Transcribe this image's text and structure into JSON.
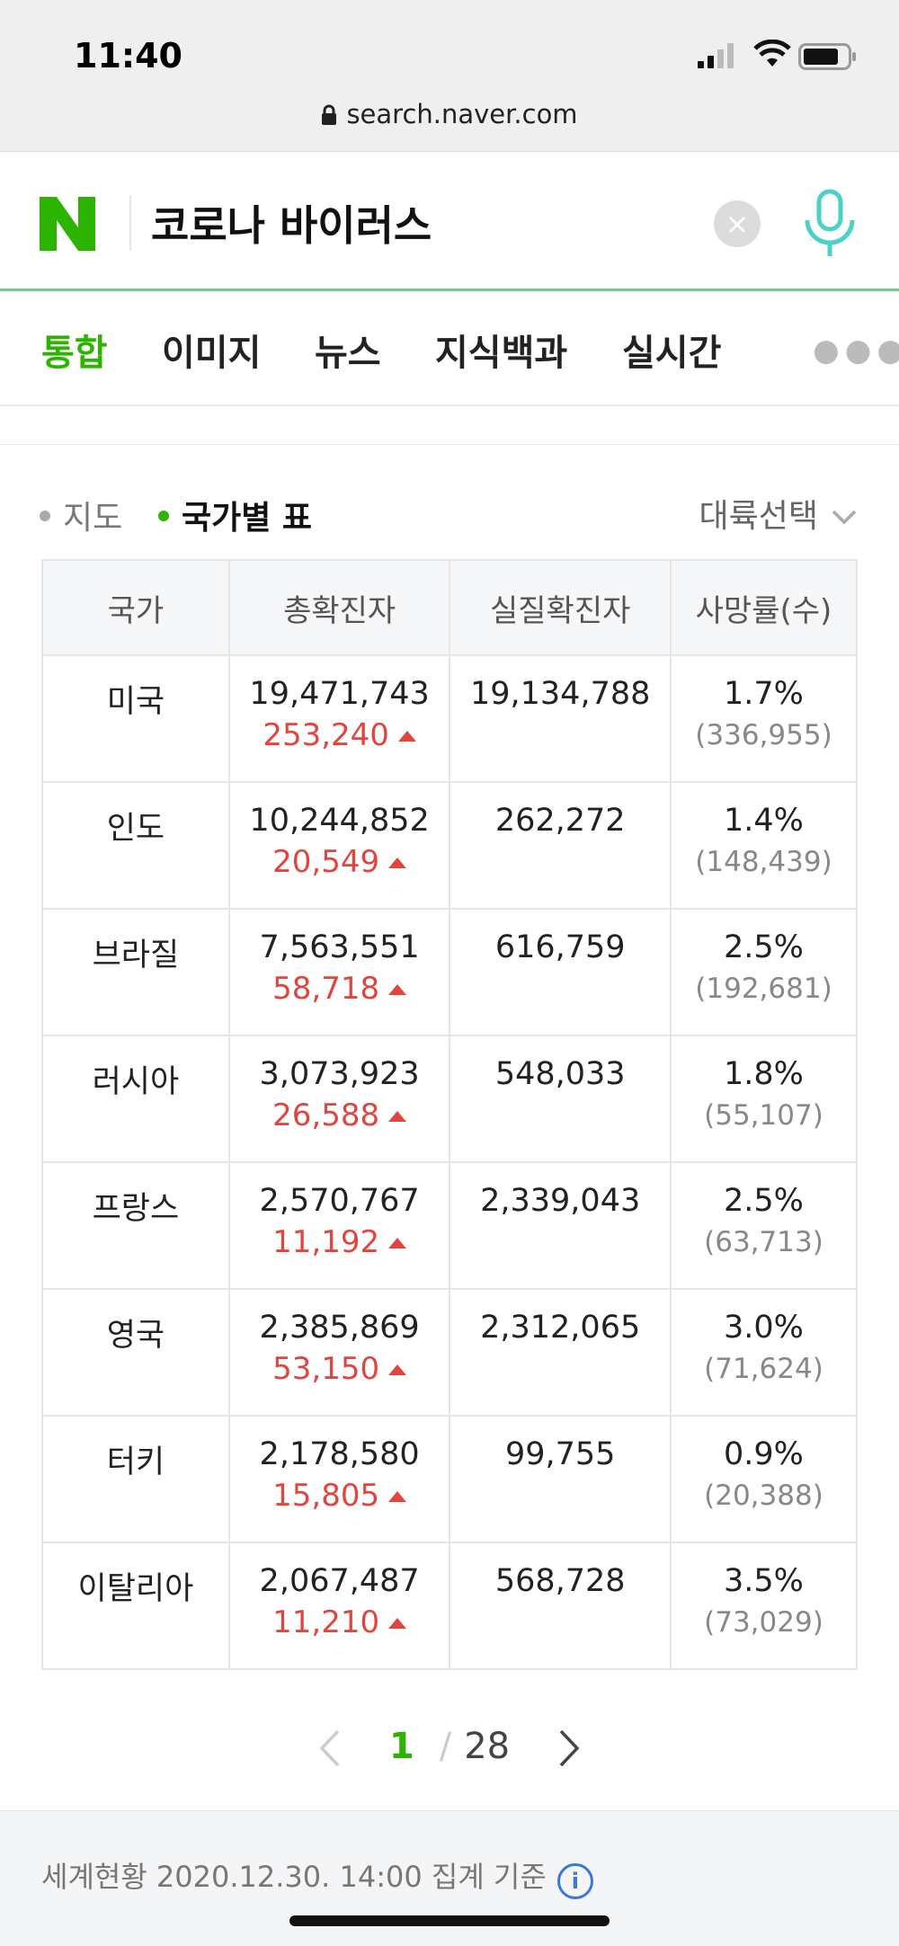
{
  "status": {
    "time": "11:40"
  },
  "browser": {
    "url": "search.naver.com"
  },
  "search": {
    "query": "코로나 바이러스",
    "clear_label": "×"
  },
  "tabs": [
    "통합",
    "이미지",
    "뉴스",
    "지식백과",
    "실시간"
  ],
  "view": {
    "map_label": "지도",
    "table_label": "국가별 표",
    "region_label": "대륙선택"
  },
  "table": {
    "headers": [
      "국가",
      "총확진자",
      "실질확진자",
      "사망률(수)"
    ],
    "rows": [
      {
        "country": "미국",
        "total": "19,471,743",
        "increase": "253,240",
        "actual": "19,134,788",
        "rate": "1.7%",
        "deaths": "(336,955)"
      },
      {
        "country": "인도",
        "total": "10,244,852",
        "increase": "20,549",
        "actual": "262,272",
        "rate": "1.4%",
        "deaths": "(148,439)"
      },
      {
        "country": "브라질",
        "total": "7,563,551",
        "increase": "58,718",
        "actual": "616,759",
        "rate": "2.5%",
        "deaths": "(192,681)"
      },
      {
        "country": "러시아",
        "total": "3,073,923",
        "increase": "26,588",
        "actual": "548,033",
        "rate": "1.8%",
        "deaths": "(55,107)"
      },
      {
        "country": "프랑스",
        "total": "2,570,767",
        "increase": "11,192",
        "actual": "2,339,043",
        "rate": "2.5%",
        "deaths": "(63,713)"
      },
      {
        "country": "영국",
        "total": "2,385,869",
        "increase": "53,150",
        "actual": "2,312,065",
        "rate": "3.0%",
        "deaths": "(71,624)"
      },
      {
        "country": "터키",
        "total": "2,178,580",
        "increase": "15,805",
        "actual": "99,755",
        "rate": "0.9%",
        "deaths": "(20,388)"
      },
      {
        "country": "이탈리아",
        "total": "2,067,487",
        "increase": "11,210",
        "actual": "568,728",
        "rate": "3.5%",
        "deaths": "(73,029)"
      }
    ]
  },
  "pagination": {
    "current": "1",
    "separator": "/",
    "total": "28"
  },
  "footer": {
    "text": "세계현황 2020.12.30. 14:00 집계 기준",
    "info_label": "i"
  },
  "colors": {
    "accent": "#2db400",
    "increase": "#e0463f",
    "mic": "#4dd0c8"
  }
}
